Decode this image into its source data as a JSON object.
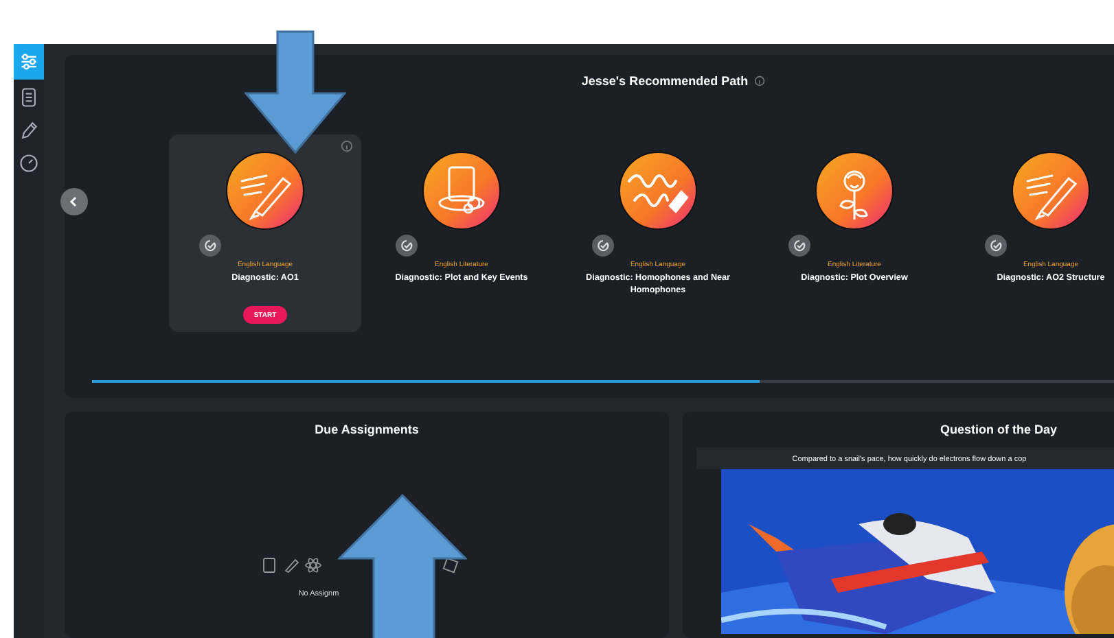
{
  "sidebar": {
    "items": [
      {
        "kind": "sliders",
        "selected": true
      },
      {
        "kind": "list",
        "selected": false
      },
      {
        "kind": "pencil",
        "selected": false
      },
      {
        "kind": "gauge",
        "selected": false
      }
    ]
  },
  "recommended_path": {
    "title": "Jesse's Recommended Path",
    "cards": [
      {
        "subject": "English Language",
        "title": "Diagnostic: AO1",
        "kind": "pen",
        "selected": true,
        "button": "START"
      },
      {
        "subject": "English Literature",
        "title": "Diagnostic: Plot and Key Events",
        "kind": "hat",
        "selected": false
      },
      {
        "subject": "English Language",
        "title": "Diagnostic: Homophones and Near Homophones",
        "kind": "script",
        "selected": false
      },
      {
        "subject": "English Literature",
        "title": "Diagnostic: Plot Overview",
        "kind": "rose",
        "selected": false
      },
      {
        "subject": "English Language",
        "title": "Diagnostic: AO2 Structure",
        "kind": "pen",
        "selected": false
      }
    ]
  },
  "due_assignments": {
    "title": "Due Assignments",
    "message": "No Assignm"
  },
  "question_of_the_day": {
    "title": "Question of the Day",
    "question": "Compared to a snail's pace, how quickly do electrons flow down a cop"
  }
}
